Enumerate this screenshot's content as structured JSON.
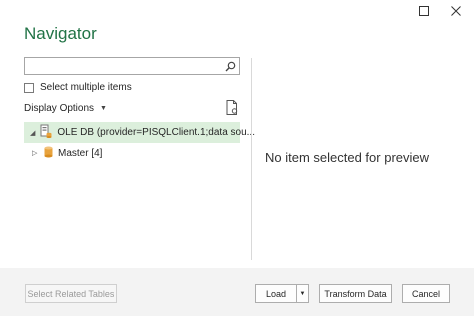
{
  "window": {
    "minimize_icon": "maximize-icon",
    "close_icon": "close-icon"
  },
  "title": "Navigator",
  "search": {
    "value": "",
    "placeholder": "",
    "icon": "search-icon"
  },
  "select_multiple": {
    "label": "Select multiple items",
    "checked": false
  },
  "display_options": {
    "label": "Display Options",
    "icon": "caret-down-icon"
  },
  "tree": [
    {
      "label": "OLE DB (provider=PISQLClient.1;data sou...",
      "expanded": true,
      "selected": true,
      "icon": "server-icon"
    },
    {
      "label": "Master [4]",
      "expanded": false,
      "selected": false,
      "icon": "database-icon"
    }
  ],
  "preview": {
    "empty_text": "No item selected for preview"
  },
  "footer": {
    "select_related": "Select Related Tables",
    "load": "Load",
    "transform": "Transform Data",
    "cancel": "Cancel"
  },
  "colors": {
    "accent": "#217346",
    "selection": "#dcefdc",
    "footer_bg": "#f3f3f3"
  }
}
